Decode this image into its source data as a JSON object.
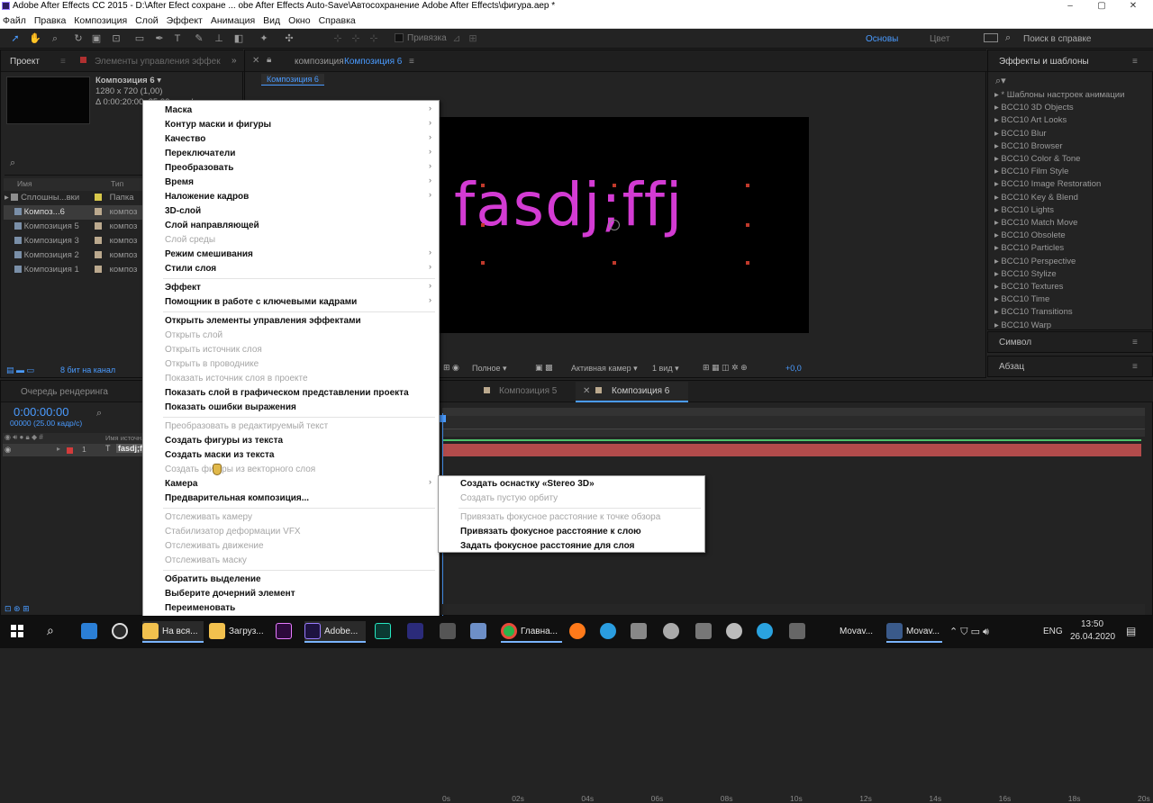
{
  "window": {
    "title": "Adobe After Effects CC 2015 - D:\\After Efect сохране ... obe After Effects Auto-Save\\Автосохранение Adobe After Effects\\фигура.aep *",
    "min": "–",
    "max": "▢",
    "close": "✕"
  },
  "menu": [
    "Файл",
    "Правка",
    "Композиция",
    "Слой",
    "Эффект",
    "Анимация",
    "Вид",
    "Окно",
    "Справка"
  ],
  "toolbar": {
    "snap": "Привязка",
    "workspace": "Основы",
    "color": "Цвет",
    "help_placeholder": "Поиск в справке"
  },
  "project": {
    "tab": "Проект",
    "tab2": "Элементы управления эффек",
    "comp_name": "Композиция 6",
    "comp_info": "1280 x 720 (1,00)",
    "comp_dur": "Δ 0:00:20:00, 25,00 кадр/с",
    "search": "",
    "col_name": "Имя",
    "col_type": "Тип",
    "items": [
      {
        "name": "Сплошны...вки",
        "type": "Папка",
        "folder": true
      },
      {
        "name": "Композ...6",
        "type": "композ"
      },
      {
        "name": "Композиция 5",
        "type": "композ"
      },
      {
        "name": "Композиция 3",
        "type": "композ"
      },
      {
        "name": "Композиция 2",
        "type": "композ"
      },
      {
        "name": "Композиция 1",
        "type": "композ"
      }
    ],
    "bits": "8 бит на канал"
  },
  "viewer": {
    "tab_prefix": "композиция",
    "tab_name": "Композиция 6",
    "crumb": "Композиция 6",
    "text": "fasdj;ffj",
    "text_color": "#d33bd3",
    "quality": "Полное",
    "camera": "Активная камер",
    "views": "1 вид",
    "exposure": "+0,0"
  },
  "effects": {
    "title": "Эффекты и шаблоны",
    "items": [
      "* Шаблоны настроек анимации",
      "BCC10 3D Objects",
      "BCC10 Art Looks",
      "BCC10 Blur",
      "BCC10 Browser",
      "BCC10 Color & Tone",
      "BCC10 Film Style",
      "BCC10 Image Restoration",
      "BCC10 Key & Blend",
      "BCC10 Lights",
      "BCC10 Match Move",
      "BCC10 Obsolete",
      "BCC10 Particles",
      "BCC10 Perspective",
      "BCC10 Stylize",
      "BCC10 Textures",
      "BCC10 Time",
      "BCC10 Transitions",
      "BCC10 Warp"
    ],
    "symbol": "Символ",
    "paragraph": "Абзац"
  },
  "timeline": {
    "render_queue": "Очередь рендеринга",
    "tab5": "Композиция 5",
    "tab6": "Композиция 6",
    "timecode": "0:00:00:00",
    "fps": "00000 (25.00 кадр/с)",
    "col_source": "Имя источн...",
    "layer_num": "1",
    "layer_name": "fasdj;f",
    "ruler": [
      "0s",
      "02s",
      "04s",
      "06s",
      "08s",
      "10s",
      "12s",
      "14s",
      "16s",
      "18s",
      "20s"
    ]
  },
  "context_menu": [
    {
      "label": "Маска",
      "sub": true
    },
    {
      "label": "Контур маски и фигуры",
      "sub": true
    },
    {
      "label": "Качество",
      "sub": true
    },
    {
      "label": "Переключатели",
      "sub": true
    },
    {
      "label": "Преобразовать",
      "sub": true
    },
    {
      "label": "Время",
      "sub": true
    },
    {
      "label": "Наложение кадров",
      "sub": true
    },
    {
      "label": "3D-слой"
    },
    {
      "label": "Слой направляющей"
    },
    {
      "label": "Слой среды",
      "dis": true
    },
    {
      "label": "Режим смешивания",
      "sub": true
    },
    {
      "label": "Стили слоя",
      "sub": true
    },
    {
      "sep": true
    },
    {
      "label": "Эффект",
      "sub": true
    },
    {
      "label": "Помощник в работе с ключевыми кадрами",
      "sub": true
    },
    {
      "sep": true
    },
    {
      "label": "Открыть элементы управления эффектами"
    },
    {
      "label": "Открыть слой",
      "dis": true
    },
    {
      "label": "Открыть источник слоя",
      "dis": true
    },
    {
      "label": "Открыть в проводнике",
      "dis": true
    },
    {
      "label": "Показать источник слоя в проекте",
      "dis": true
    },
    {
      "label": "Показать слой в графическом представлении проекта"
    },
    {
      "label": "Показать ошибки выражения"
    },
    {
      "sep": true
    },
    {
      "label": "Преобразовать в редактируемый текст",
      "dis": true
    },
    {
      "label": "Создать фигуры из текста"
    },
    {
      "label": "Создать маски из текста"
    },
    {
      "label": "Создать фигуры из векторного слоя",
      "dis": true
    },
    {
      "label": "Камера",
      "sub": true
    },
    {
      "label": "Предварительная композиция..."
    },
    {
      "sep": true
    },
    {
      "label": "Отслеживать камеру",
      "dis": true
    },
    {
      "label": "Стабилизатор деформации VFX",
      "dis": true
    },
    {
      "label": "Отслеживать движение",
      "dis": true
    },
    {
      "label": "Отслеживать маску",
      "dis": true
    },
    {
      "sep": true
    },
    {
      "label": "Обратить выделение"
    },
    {
      "label": "Выберите дочерний элемент"
    },
    {
      "label": "Переименовать"
    }
  ],
  "camera_submenu": [
    {
      "label": "Создать оснастку «Stereo 3D»"
    },
    {
      "label": "Создать пустую орбиту",
      "dis": true
    },
    {
      "sep": true
    },
    {
      "label": "Привязать фокусное расстояние к точке обзора",
      "dis": true
    },
    {
      "label": "Привязать фокусное расстояние к слою"
    },
    {
      "label": "Задать фокусное расстояние для слоя"
    }
  ],
  "taskbar": {
    "items": [
      "На вся...",
      "Загруз...",
      "",
      "Adobe...",
      "",
      "",
      "",
      "Главна..."
    ],
    "movavi1": "Movav...",
    "movavi2": "Movav...",
    "lang": "ENG",
    "time": "13:50",
    "date": "26.04.2020"
  }
}
